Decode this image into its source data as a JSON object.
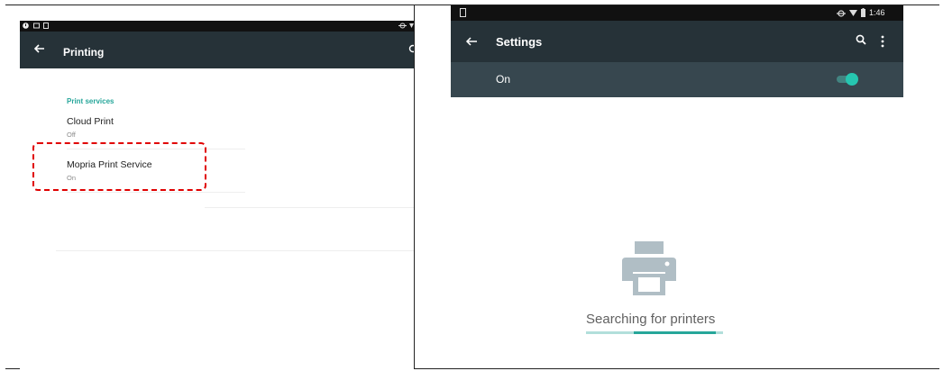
{
  "left": {
    "title": "Printing",
    "section_header": "Print services",
    "services": [
      {
        "name": "Cloud Print",
        "status": "Off"
      },
      {
        "name": "Mopria Print Service",
        "status": "On"
      }
    ]
  },
  "right": {
    "status_time": "1:46",
    "title": "Settings",
    "switch_label": "On",
    "switch_on": true,
    "message": "Searching for printers",
    "progress_fraction_start": 0.35,
    "progress_fraction_end": 0.95
  },
  "colors": {
    "appbar": "#263238",
    "switchbar": "#37474f",
    "accent": "#26a69a",
    "highlight": "#e00000"
  },
  "icons": [
    "back-arrow-icon",
    "search-icon",
    "more-vert-icon",
    "printer-icon",
    "wifi-icon",
    "battery-icon"
  ]
}
